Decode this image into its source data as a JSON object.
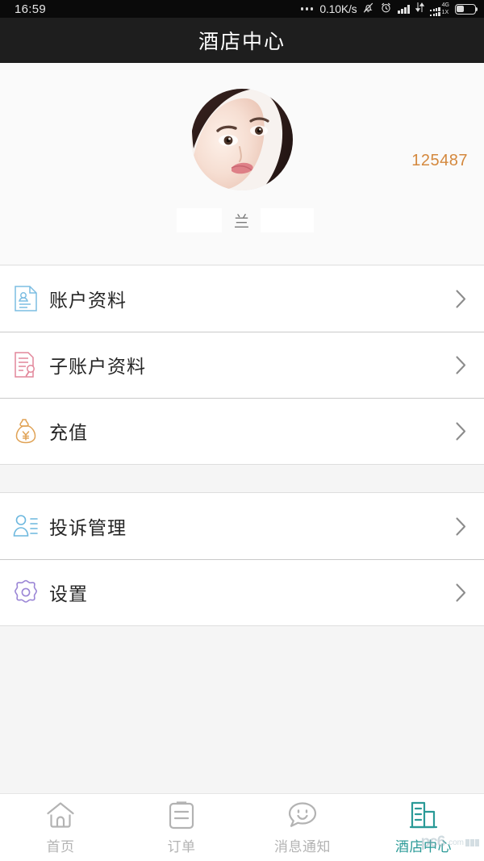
{
  "status_bar": {
    "time": "16:59",
    "network_speed": "0.10K/s",
    "overflow_dots": "...",
    "icons": [
      "mute-bell-icon",
      "alarm-clock-icon",
      "signal-bars-icon",
      "data-transfer-icon",
      "dual-sim-signal-icon",
      "battery-icon"
    ],
    "net_type_primary": "4G",
    "net_type_secondary": "1X"
  },
  "header": {
    "title": "酒店中心"
  },
  "profile": {
    "points": "125487",
    "username": "兰",
    "avatar_alt": "user-avatar-photo"
  },
  "menu": {
    "group_one": [
      {
        "label": "账户资料",
        "icon": "account-document-icon",
        "color": "#6cb7de",
        "chevron": "chevron-right-icon"
      },
      {
        "label": "子账户资料",
        "icon": "sub-account-document-icon",
        "color": "#e2869a",
        "chevron": "chevron-right-icon"
      },
      {
        "label": "充值",
        "icon": "money-bag-recharge-icon",
        "color": "#e0a255",
        "chevron": "chevron-right-icon"
      }
    ],
    "group_two": [
      {
        "label": "投诉管理",
        "icon": "complaint-person-list-icon",
        "color": "#6cb7de",
        "chevron": "chevron-right-icon"
      },
      {
        "label": "设置",
        "icon": "settings-gear-icon",
        "color": "#9b86d6",
        "chevron": "chevron-right-icon"
      }
    ]
  },
  "tabbar": {
    "items": [
      {
        "label": "首页",
        "icon": "home-icon",
        "active": false
      },
      {
        "label": "订单",
        "icon": "clipboard-orders-icon",
        "active": false
      },
      {
        "label": "消息通知",
        "icon": "message-smiley-icon",
        "active": false
      },
      {
        "label": "酒店中心",
        "icon": "hotel-building-icon",
        "active": true
      }
    ],
    "active_color": "#2a9a97",
    "inactive_color": "#b3b3b3"
  },
  "watermark": {
    "text": "pc6",
    "domain": ".com"
  },
  "colors": {
    "accent_orange": "#d4883d",
    "active_teal": "#2a9a97",
    "header_bg": "#1e1e1e",
    "page_bg": "#f5f5f5"
  }
}
